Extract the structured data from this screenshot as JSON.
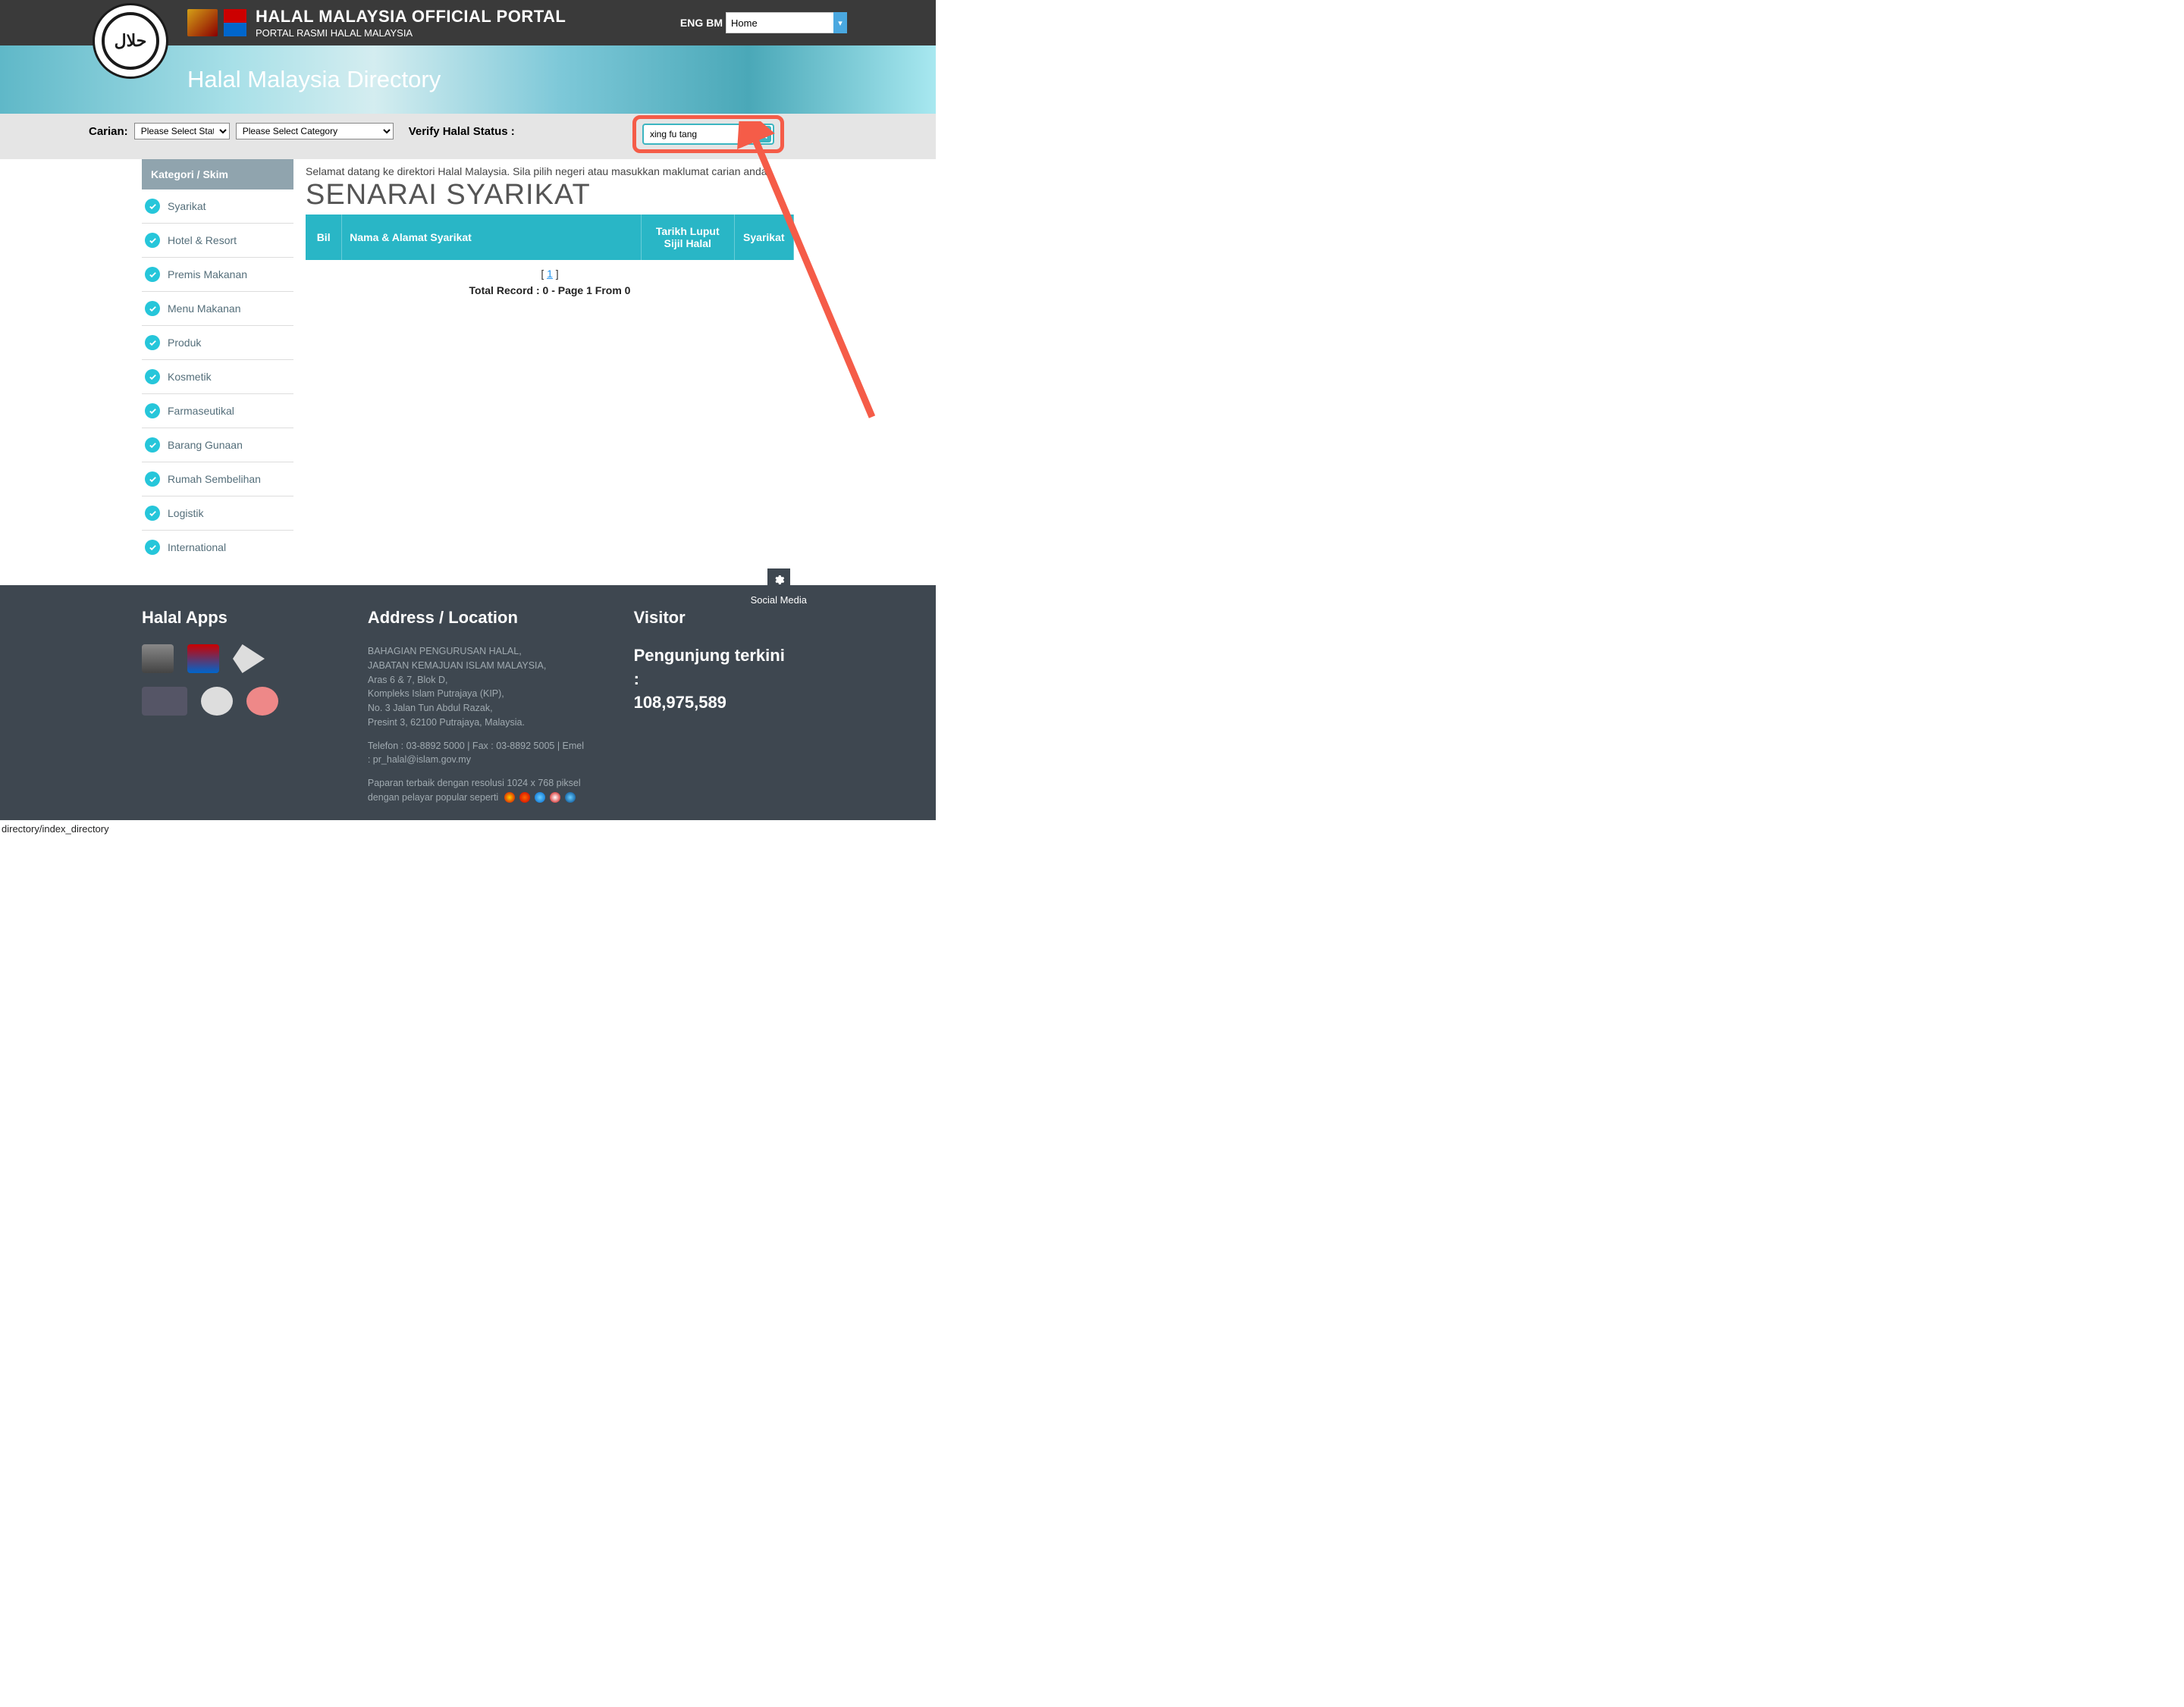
{
  "header": {
    "portal_title": "HALAL MALAYSIA OFFICIAL PORTAL",
    "portal_subtitle": "PORTAL RASMI HALAL MALAYSIA",
    "lang_eng": "ENG",
    "lang_bm": "BM",
    "home_select": "Home"
  },
  "banner": {
    "title": "Halal Malaysia Directory"
  },
  "filter": {
    "carian_label": "Carian:",
    "state_placeholder": "Please Select State",
    "category_placeholder": "Please Select Category",
    "verify_label": "Verify Halal Status :",
    "search_value": "xing fu tang"
  },
  "sidebar": {
    "header": "Kategori / Skim",
    "items": [
      "Syarikat",
      "Hotel & Resort",
      "Premis Makanan",
      "Menu Makanan",
      "Produk",
      "Kosmetik",
      "Farmaseutikal",
      "Barang Gunaan",
      "Rumah Sembelihan",
      "Logistik",
      "International"
    ]
  },
  "content": {
    "welcome": "Selamat datang ke direktori Halal Malaysia. Sila pilih negeri atau masukkan maklumat carian anda.",
    "title": "SENARAI SYARIKAT",
    "columns": {
      "bil": "Bil",
      "name": "Nama & Alamat Syarikat",
      "expiry": "Tarikh Luput Sijil Halal",
      "company": "Syarikat"
    },
    "pagination_current": "1",
    "total_record": "Total Record : 0 - Page 1 From 0"
  },
  "footer": {
    "apps_header": "Halal Apps",
    "address_header": "Address / Location",
    "address_lines": [
      "BAHAGIAN PENGURUSAN HALAL,",
      "JABATAN KEMAJUAN ISLAM MALAYSIA,",
      "Aras 6 & 7, Blok D,",
      "Kompleks Islam Putrajaya (KIP),",
      "No. 3 Jalan Tun Abdul Razak,",
      "Presint 3, 62100 Putrajaya, Malaysia."
    ],
    "contact": "Telefon : 03-8892 5000 | Fax : 03-8892 5005 | Emel : pr_halal@islam.gov.my",
    "best_view": "Paparan terbaik dengan resolusi 1024 x 768 piksel dengan pelayar popular seperti",
    "visitor_header": "Visitor",
    "visitor_label": "Pengunjung terkini :",
    "visitor_count": "108,975,589",
    "social_label": "Social Media"
  },
  "status_url": "directory/index_directory"
}
